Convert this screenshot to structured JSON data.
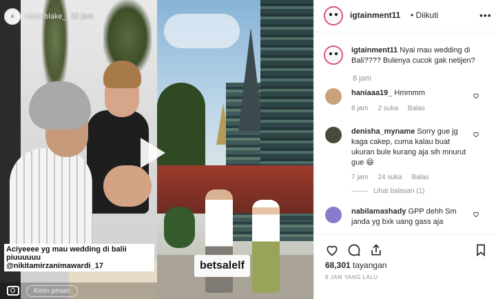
{
  "story": {
    "username": "andreblake_",
    "time": "22 jam",
    "avatar_text": "A",
    "caption_line1": "Aciyeeee yg mau wedding di balii piuuuuuu",
    "caption_line2": "@nikitamirzanimawardi_17",
    "reply_placeholder": "Kirim pesan"
  },
  "brand_label": "betsalelf",
  "post": {
    "username": "igtainment11",
    "follow_status": "• Diikuti",
    "more_icon": "ellipsis-icon",
    "caption_user": "igtainment11",
    "caption_text": " Nyai mau wedding di Bali???? Bulenya cucok gak netijen?",
    "caption_time": "8 jam"
  },
  "comments": [
    {
      "user": "haniaaa19_",
      "text": " Hmmmm",
      "time": "8 jam",
      "likes": "2 suka",
      "reply": "Balas",
      "avatar_color": "#c9a27a"
    },
    {
      "user": "denisha_myname",
      "text": " Sorry gue jg kaga cakep, cuma kalau buat ukuran bule kurang aja sih mnurut gue 😄",
      "time": "7 jam",
      "likes": "24 suka",
      "reply": "Balas",
      "view_replies": "Lihat balasan (1)",
      "avatar_color": "#4a4a3a"
    },
    {
      "user": "nabilamashady",
      "text": " GPP dehh Sm janda yg bxk uang gass aja",
      "avatar_color": "#8a7acb"
    }
  ],
  "stats": {
    "views_count": "68,301",
    "views_label": " tayangan",
    "posted_ago": "8 JAM YANG LALU"
  },
  "colors": {
    "accent_ring": "#d94f8c",
    "muted_text": "#8e8e8e",
    "text": "#262626"
  }
}
